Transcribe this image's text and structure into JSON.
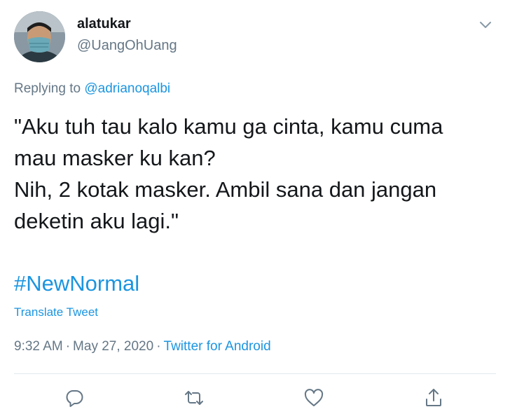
{
  "user": {
    "display_name": "alatukar",
    "handle": "@UangOhUang",
    "avatar_icon": "avatar-photo"
  },
  "reply": {
    "prefix": "Replying to ",
    "mention": "@adrianoqalbi"
  },
  "tweet": {
    "lines": [
      "\"Aku tuh tau kalo kamu ga cinta, kamu cuma",
      "mau masker ku kan?",
      "Nih, 2 kotak masker. Ambil sana dan jangan",
      "deketin aku lagi.\""
    ],
    "hashtag": "#NewNormal",
    "translate_label": "Translate Tweet"
  },
  "meta": {
    "time": "9:32 AM",
    "separator": "·",
    "date": "May 27, 2020",
    "source": "Twitter for Android"
  },
  "actions": [
    {
      "name": "reply",
      "icon": "speech-bubble-icon"
    },
    {
      "name": "retweet",
      "icon": "retweet-icon"
    },
    {
      "name": "like",
      "icon": "heart-icon"
    },
    {
      "name": "share",
      "icon": "share-icon"
    }
  ],
  "colors": {
    "link": "#1b95e0",
    "secondary_text": "#657786",
    "primary_text": "#14171a",
    "divider": "#e1e8ed"
  }
}
